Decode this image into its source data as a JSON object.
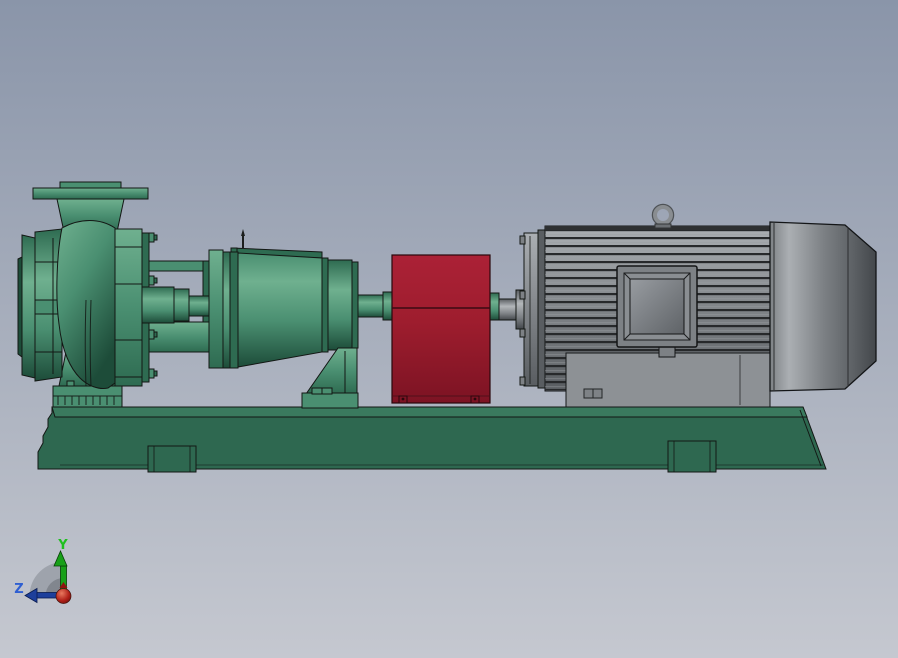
{
  "viewport": {
    "type": "cad-3d-viewport",
    "triad": {
      "y_label": "Y",
      "z_label": "Z"
    }
  },
  "components": [
    "suction-flange",
    "suction-cone",
    "volute-casing",
    "discharge-flange",
    "pump-pedestal",
    "casing-cover",
    "bearing-frame",
    "pump-shaft",
    "bearing-housing",
    "oiler-pin",
    "bearing-support-foot",
    "coupling-guard",
    "motor-coupling",
    "motor-endbell",
    "motor-body",
    "motor-terminal-box",
    "lifting-eyebolt",
    "motor-feet",
    "motor-fan-cover",
    "baseplate",
    "baseplate-foot-pad",
    "orientation-triad"
  ],
  "colors": {
    "bg_top": "#8a95a9",
    "bg_bottom": "#c5c8d0",
    "green_hi": "#6fb08f",
    "green_mid": "#4a8f71",
    "green_lo": "#2e6b51",
    "green_deep": "#1d4c39",
    "base_face": "#2e6850",
    "base_rail": "#3a7a5e",
    "red_hi": "#ab2136",
    "red_mid": "#9e1d2e",
    "red_lo": "#7c1323",
    "gray_hi": "#abafb3",
    "gray_mid": "#7d8185",
    "gray_lo": "#595d61",
    "gray_deep": "#43474b",
    "feet_gray": "#8d9195",
    "fin_line": "#27292b",
    "panel_hi": "#989ca1",
    "panel_lo": "#5f6367",
    "shaft_hi": "#b3b7ba",
    "triad_y": "#1fbf1f",
    "triad_y_arrow": "#18a018",
    "triad_z": "#2f5fd2",
    "triad_z_arrow": "#1d3f9b",
    "triad_x": "#b02018"
  }
}
